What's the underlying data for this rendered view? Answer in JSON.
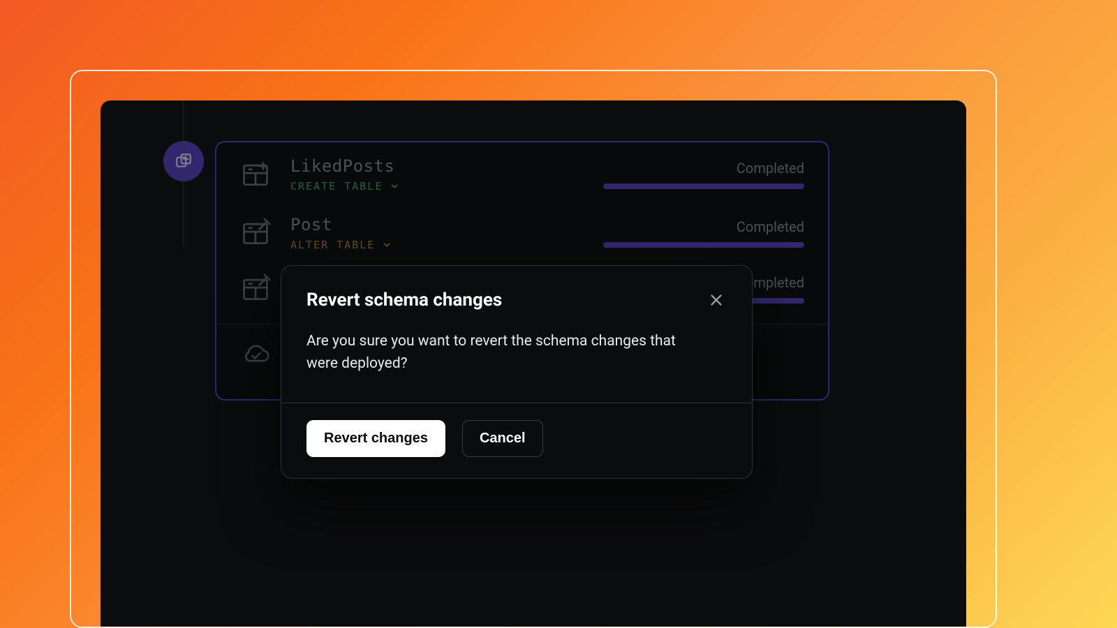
{
  "colors": {
    "accent": "#5b47c7"
  },
  "migrations": [
    {
      "title": "LikedPosts",
      "op": "CREATE TABLE",
      "op_kind": "create",
      "status": "Completed",
      "icon": "table-create-icon"
    },
    {
      "title": "Post",
      "op": "ALTER TABLE",
      "op_kind": "alter",
      "status": "Completed",
      "icon": "table-edit-icon"
    },
    {
      "title": "",
      "op": "",
      "op_kind": "alter",
      "status": "Completed",
      "icon": "table-edit-icon"
    }
  ],
  "modal": {
    "title": "Revert schema changes",
    "body": "Are you sure you want to revert the schema changes that were deployed?",
    "confirm_label": "Revert changes",
    "cancel_label": "Cancel"
  }
}
